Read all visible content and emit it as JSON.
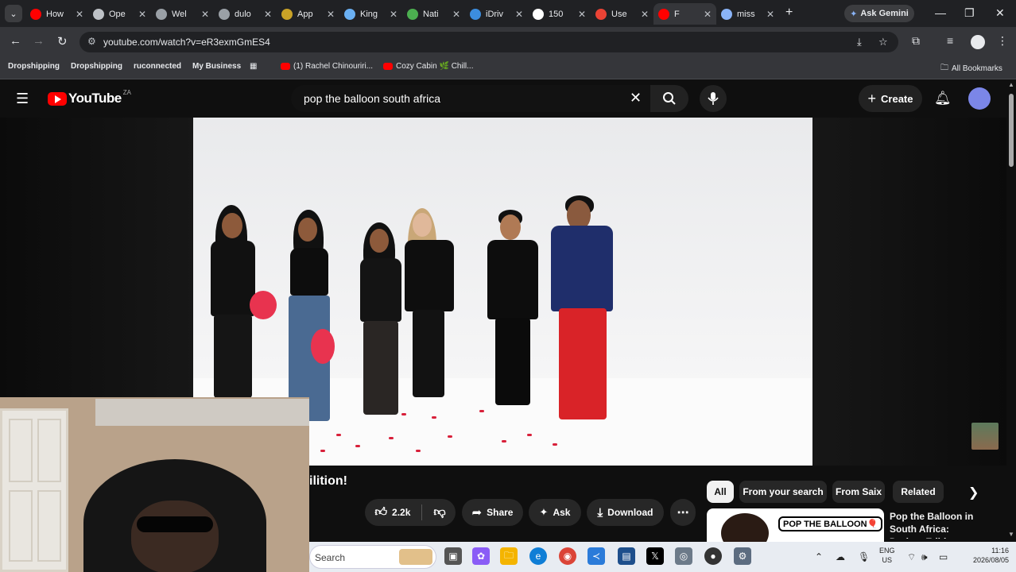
{
  "browser": {
    "tabs": [
      {
        "title": "How",
        "favicon": "youtube-icon",
        "color": "#ff0000"
      },
      {
        "title": "Ope",
        "favicon": "openai-icon",
        "color": "#bdc1c6"
      },
      {
        "title": "Wel",
        "favicon": "globe-icon",
        "color": "#9aa0a6"
      },
      {
        "title": "dulo",
        "favicon": "globe-icon",
        "color": "#9aa0a6"
      },
      {
        "title": "App",
        "favicon": "crest-icon",
        "color": "#c9a227"
      },
      {
        "title": "King",
        "favicon": "blue-circle-icon",
        "color": "#6ab0f3"
      },
      {
        "title": "Nati",
        "favicon": "map-icon",
        "color": "#4caf50"
      },
      {
        "title": "iDriv",
        "favicon": "wordpress-icon",
        "color": "#3c8dde"
      },
      {
        "title": "150",
        "favicon": "google-icon",
        "color": "#ffffff"
      },
      {
        "title": "Use",
        "favicon": "gmail-icon",
        "color": "#ea4335"
      },
      {
        "title": "F",
        "favicon": "youtube-icon",
        "color": "#ff0000",
        "active": true
      },
      {
        "title": "miss",
        "favicon": "loading-icon",
        "color": "#8ab4f8"
      }
    ],
    "ask_gemini": "Ask Gemini",
    "url": "youtube.com/watch?v=eR3exmGmES4",
    "bookmarks": [
      "Dropshipping",
      "Dropshipping",
      "ruconnected",
      "My Business",
      "(1) Rachel Chinouriri...",
      "Cozy Cabin 🌿 Chill..."
    ],
    "all_bookmarks": "All Bookmarks"
  },
  "youtube": {
    "logo_text": "YouTube",
    "country": "ZA",
    "search_query": "pop the balloon south africa",
    "create_label": "Create",
    "video_title_fragment": "ilition!",
    "likes": "2.2k",
    "share_label": "Share",
    "ask_label": "Ask",
    "download_label": "Download",
    "chips": [
      "All",
      "From your search",
      "From Saix",
      "Related"
    ],
    "recommended": {
      "title": "Pop the Balloon in South Africa: Durban Edition",
      "thumb_text": "POP THE BALLOON🎈"
    }
  },
  "taskbar": {
    "search_placeholder": "Search",
    "language": "ENG",
    "region": "US",
    "time": "11:16",
    "date": "2026/08/05"
  },
  "colors": {
    "yt_red": "#ff0000",
    "chrome_dark": "#202124",
    "yt_bg": "#0f0f0f"
  }
}
